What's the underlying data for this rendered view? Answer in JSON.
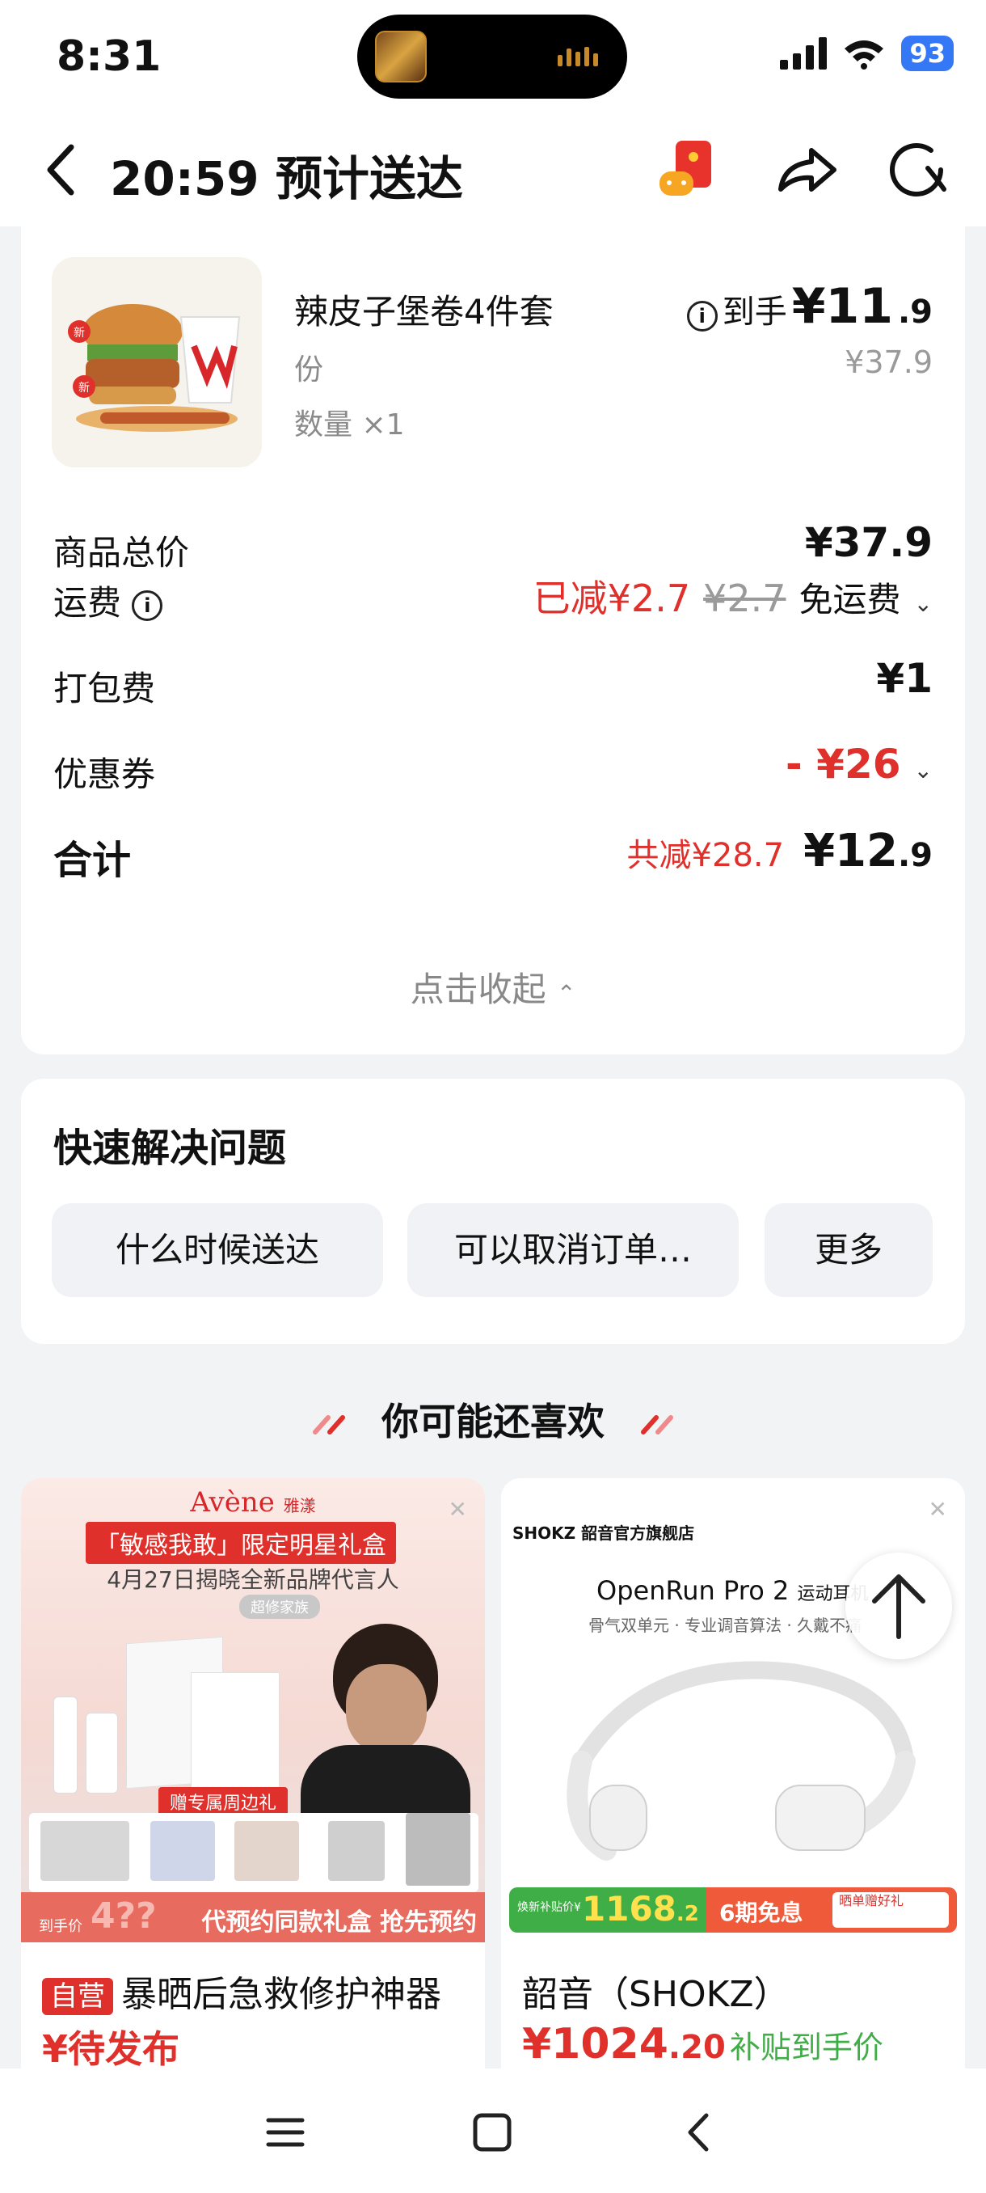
{
  "status_bar": {
    "time": "8:31",
    "battery": "93"
  },
  "header": {
    "title": "20:59 预计送达"
  },
  "order": {
    "item_name": "辣皮子堡卷4件套",
    "item_unit": "份",
    "item_qty": "数量 ×1",
    "price_label": "到手",
    "price_int": "¥11",
    "price_dec": ".9",
    "original_price": "¥37.9",
    "rows": {
      "subtotal_label": "商品总价",
      "subtotal_value": "¥37.9",
      "delivery_label": "运费",
      "delivery_reduced": "已减¥2.7",
      "delivery_strike": "¥2.7",
      "delivery_free": "免运费",
      "packing_label": "打包费",
      "packing_value": "¥1",
      "coupon_label": "优惠券",
      "coupon_value": "- ¥26",
      "total_label": "合计",
      "total_reduced": "共减¥28.7",
      "total_int": "¥12",
      "total_dec": ".9"
    },
    "collapse": "点击收起"
  },
  "quick": {
    "title": "快速解决问题",
    "chips": [
      "什么时候送达",
      "可以取消订单…",
      "更多"
    ]
  },
  "recommend": {
    "title": "你可能还喜欢",
    "products": [
      {
        "tag": "自营",
        "name": "暴晒后急救修护神器",
        "price": "¥待发布",
        "banner": {
          "brand": "Avène",
          "brand_cn": "雅漾",
          "headline": "「敏感我敢」限定明星礼盒",
          "sub": "4月27日揭晓全新品牌代言人",
          "pill": "超修家族",
          "gift": "赠专属周边礼",
          "price_tag": "到手价",
          "price_q": "4??",
          "preorder": "代预约同款礼盒 抢先预约"
        }
      },
      {
        "name": "韶音（SHOKZ）",
        "price_int": "¥1024",
        "price_dec": ".20",
        "price_note": "补贴到手价",
        "banner": {
          "store": "SHOKZ 韶音官方旗舰店",
          "model": "OpenRun Pro 2",
          "model_sub": "运动耳机",
          "features": "骨气双单元 · 专业调音算法 · 久戴不痛",
          "subsidy_label": "焕新补贴价¥",
          "subsidy_price": "1168",
          "subsidy_dec": ".2",
          "installment": "6期免息",
          "gift": "晒单赠好礼"
        }
      }
    ]
  },
  "colors": {
    "accent_red": "#e0302b",
    "battery_blue": "#3478f6",
    "bg_gray": "#f2f3f5"
  }
}
